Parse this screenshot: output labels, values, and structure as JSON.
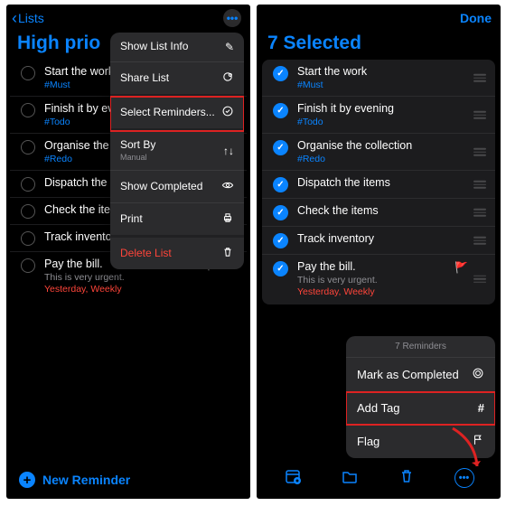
{
  "left": {
    "nav": {
      "back": "Lists"
    },
    "title": "High prio",
    "items": [
      {
        "title": "Start the work",
        "tag": "#Must"
      },
      {
        "title": "Finish it by ev",
        "tag": "#Todo"
      },
      {
        "title": "Organise the",
        "tag": "#Redo"
      },
      {
        "title": "Dispatch the i"
      },
      {
        "title": "Check the iter"
      },
      {
        "title": "Track inventory"
      },
      {
        "title": "Pay the bill.",
        "sub": "This is very urgent.",
        "due": "Yesterday, Weekly",
        "flag": true
      }
    ],
    "menu": [
      {
        "label": "Show List Info",
        "icon": "pencil"
      },
      {
        "label": "Share List",
        "icon": "share",
        "group_end": true
      },
      {
        "label": "Select Reminders...",
        "icon": "check-circle",
        "highlight": true,
        "group_end": true
      },
      {
        "label": "Sort By",
        "sub": "Manual",
        "icon": "sort"
      },
      {
        "label": "Show Completed",
        "icon": "eye"
      },
      {
        "label": "Print",
        "icon": "print",
        "group_end": true
      },
      {
        "label": "Delete List",
        "icon": "trash",
        "danger": true
      }
    ],
    "new_reminder": "New Reminder"
  },
  "right": {
    "nav": {
      "done": "Done"
    },
    "title": "7 Selected",
    "items": [
      {
        "title": "Start the work",
        "tag": "#Must"
      },
      {
        "title": "Finish it by evening",
        "tag": "#Todo"
      },
      {
        "title": "Organise the collection",
        "tag": "#Redo"
      },
      {
        "title": "Dispatch the items"
      },
      {
        "title": "Check the items"
      },
      {
        "title": "Track inventory"
      },
      {
        "title": "Pay the bill.",
        "sub": "This is very urgent.",
        "due": "Yesterday, Weekly",
        "flag": true
      }
    ],
    "sheet": {
      "header": "7 Reminders",
      "rows": [
        {
          "label": "Mark as Completed",
          "icon": "circle"
        },
        {
          "label": "Add Tag",
          "icon": "hash",
          "highlight": true
        },
        {
          "label": "Flag",
          "icon": "flag"
        }
      ]
    }
  }
}
